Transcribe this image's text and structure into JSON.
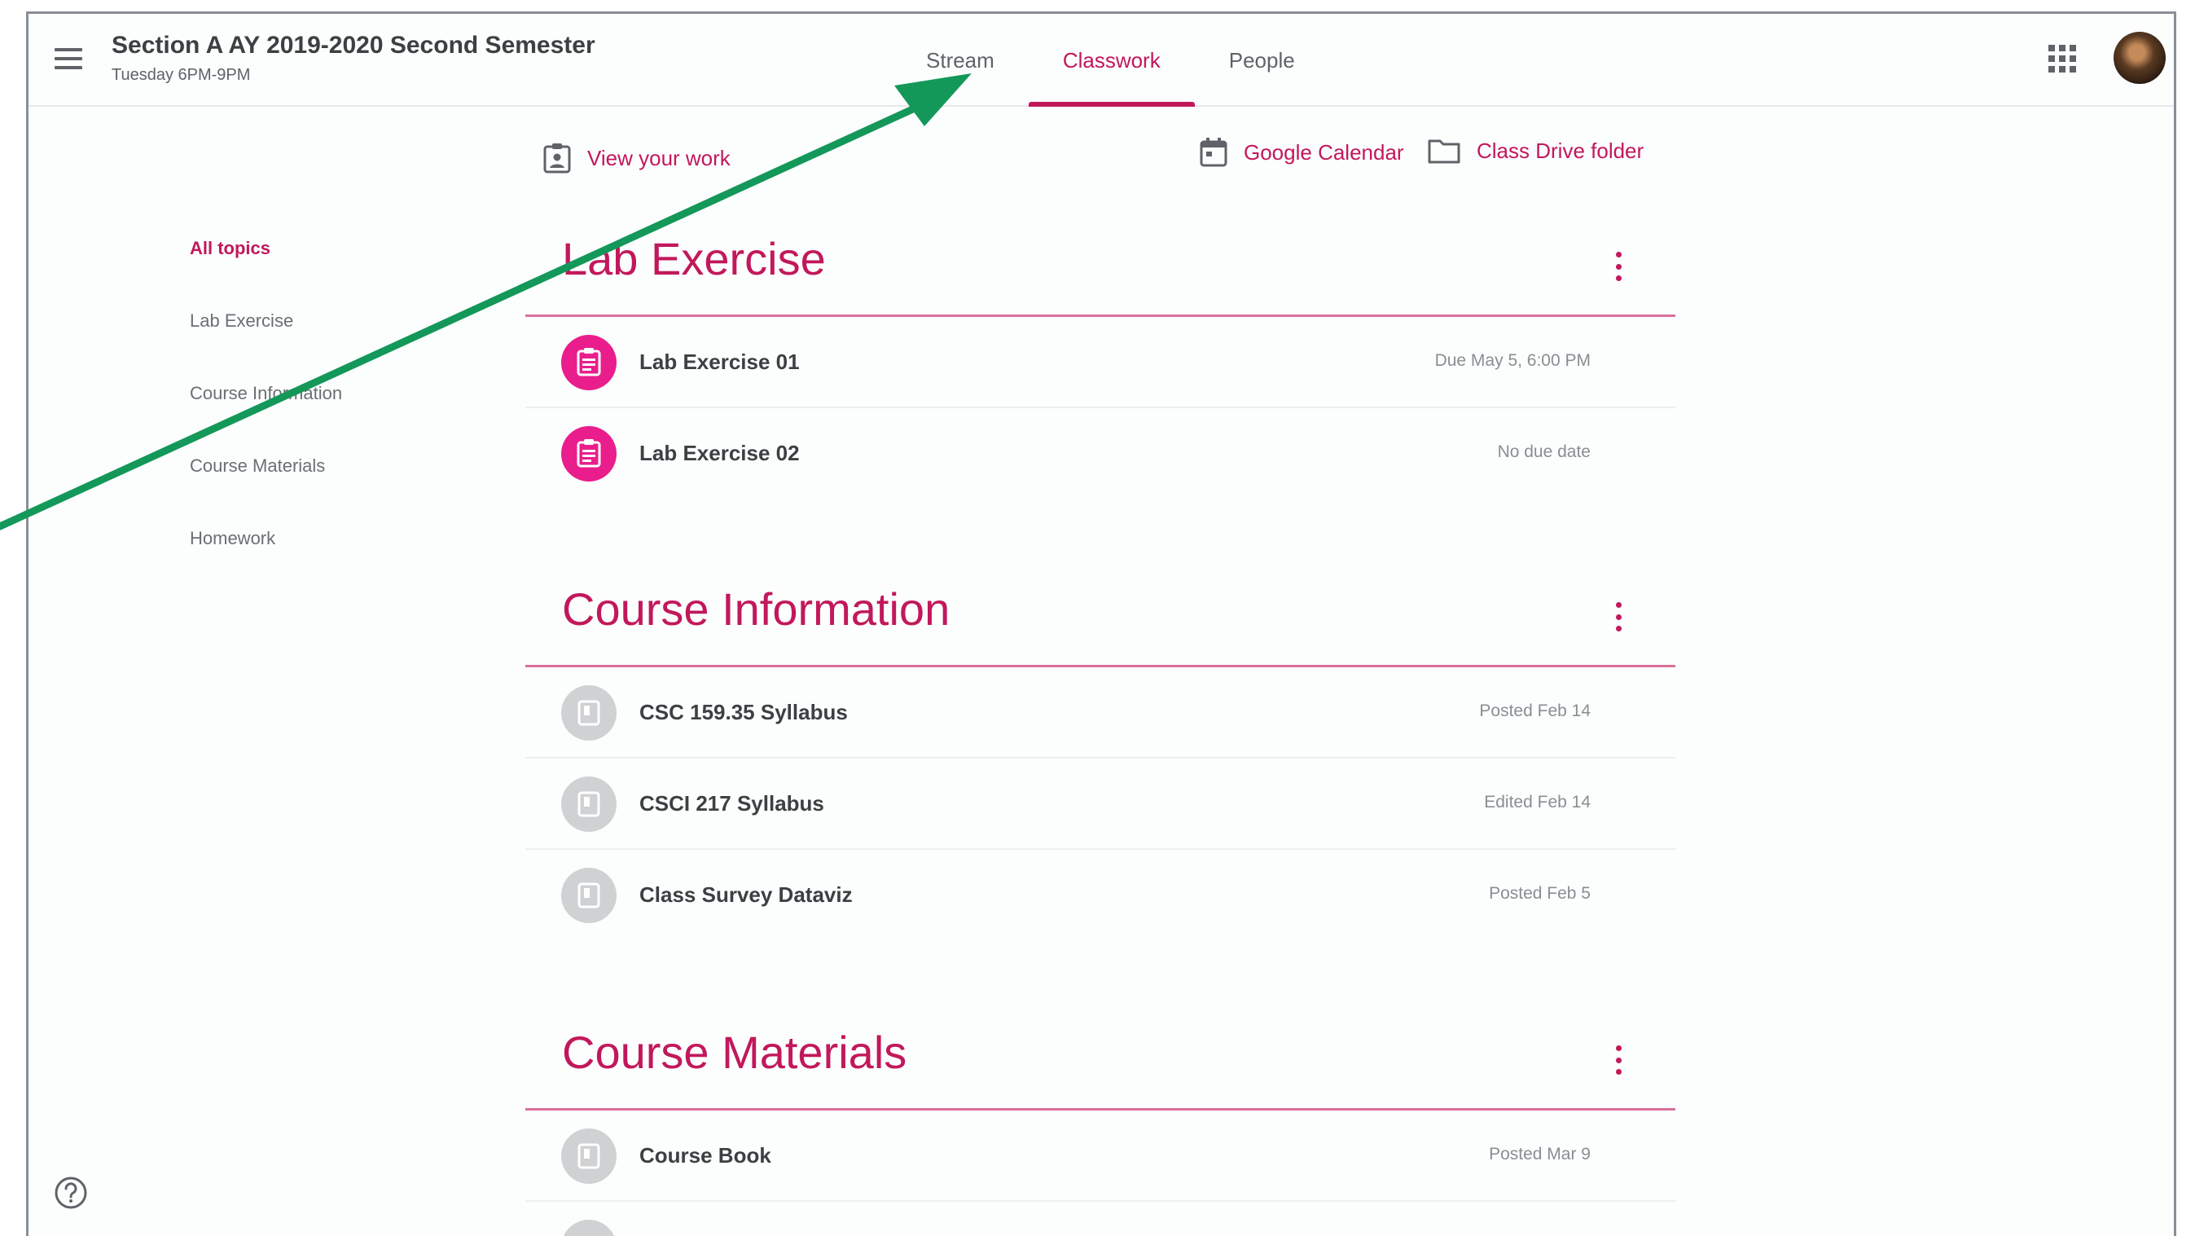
{
  "header": {
    "class_title": "Section A AY 2019-2020 Second Semester",
    "class_subtitle": "Tuesday 6PM-9PM",
    "tabs": [
      {
        "label": "Stream"
      },
      {
        "label": "Classwork",
        "active": true
      },
      {
        "label": "People"
      }
    ]
  },
  "actions": {
    "view_work": "View your work",
    "google_calendar": "Google Calendar",
    "drive_folder": "Class Drive folder"
  },
  "sidebar": {
    "items": [
      {
        "label": "All topics",
        "active": true
      },
      {
        "label": "Lab Exercise"
      },
      {
        "label": "Course Information"
      },
      {
        "label": "Course Materials"
      },
      {
        "label": "Homework"
      }
    ]
  },
  "sections": [
    {
      "title": "Lab Exercise",
      "items": [
        {
          "title": "Lab Exercise 01",
          "meta": "Due May 5, 6:00 PM",
          "icon": "assignment-icon"
        },
        {
          "title": "Lab Exercise 02",
          "meta": "No due date",
          "icon": "assignment-icon"
        }
      ]
    },
    {
      "title": "Course Information",
      "items": [
        {
          "title": "CSC 159.35 Syllabus",
          "meta": "Posted Feb 14",
          "icon": "material-icon"
        },
        {
          "title": "CSCI 217 Syllabus",
          "meta": "Edited Feb 14",
          "icon": "material-icon"
        },
        {
          "title": "Class Survey Dataviz",
          "meta": "Posted Feb 5",
          "icon": "material-icon"
        }
      ]
    },
    {
      "title": "Course Materials",
      "items": [
        {
          "title": "Course Book",
          "meta": "Posted Mar 9",
          "icon": "material-icon"
        }
      ]
    }
  ],
  "colors": {
    "accent": "#c2185b",
    "assignment_badge": "#e91e8c",
    "annotation_arrow": "#13985a"
  }
}
